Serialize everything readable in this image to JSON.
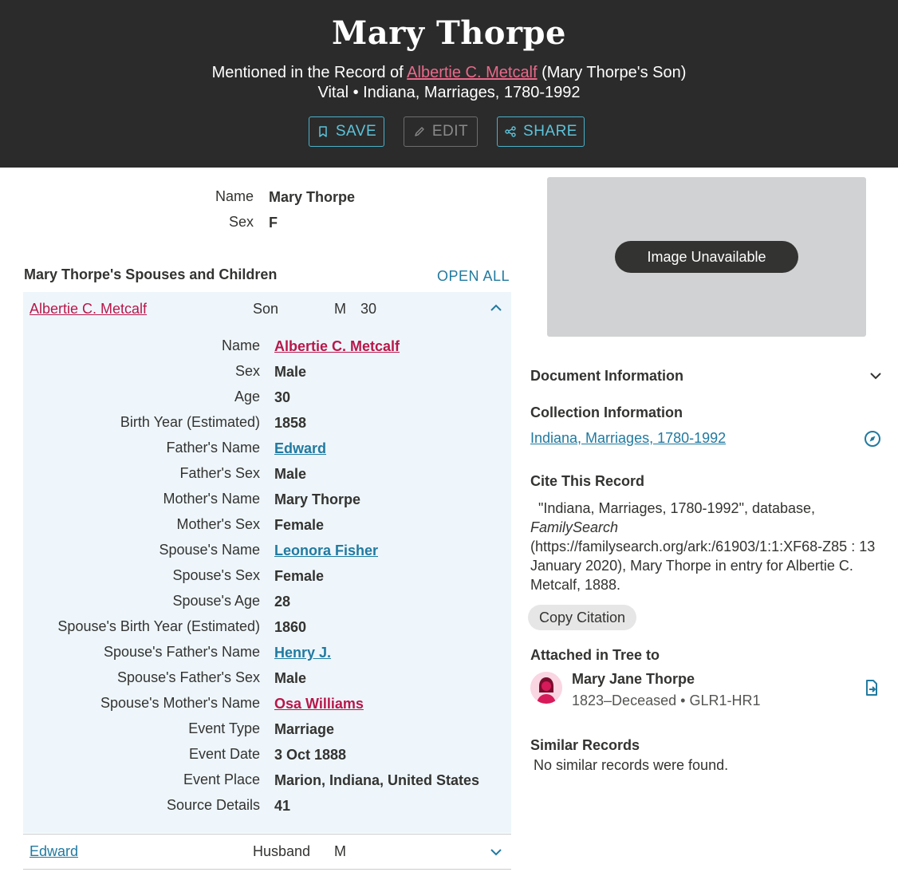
{
  "header": {
    "title": "Mary Thorpe",
    "mentioned_prefix": "Mentioned in the Record of ",
    "mentioned_link": "Albertie C. Metcalf",
    "mentioned_suffix": " (Mary Thorpe's Son)",
    "collection_line": "Vital • Indiana, Marriages, 1780-1992",
    "buttons": {
      "save": "SAVE",
      "edit": "EDIT",
      "share": "SHARE"
    }
  },
  "summary": {
    "name_label": "Name",
    "name_value": "Mary Thorpe",
    "sex_label": "Sex",
    "sex_value": "F"
  },
  "spouses_section": {
    "title": "Mary Thorpe's Spouses and Children",
    "open_all": "OPEN ALL",
    "expanded": {
      "name": "Albertie C. Metcalf",
      "relationship": "Son",
      "sex": "M",
      "age": "30",
      "details": [
        {
          "label": "Name",
          "value": "Albertie C. Metcalf"
        },
        {
          "label": "Sex",
          "value": "Male"
        },
        {
          "label": "Age",
          "value": "30"
        },
        {
          "label": "Birth Year (Estimated)",
          "value": "1858"
        },
        {
          "label": "Father's Name",
          "value": "Edward"
        },
        {
          "label": "Father's Sex",
          "value": "Male"
        },
        {
          "label": "Mother's Name",
          "value": "Mary Thorpe"
        },
        {
          "label": "Mother's Sex",
          "value": "Female"
        },
        {
          "label": "Spouse's Name",
          "value": "Leonora Fisher"
        },
        {
          "label": "Spouse's Sex",
          "value": "Female"
        },
        {
          "label": "Spouse's Age",
          "value": "28"
        },
        {
          "label": "Spouse's Birth Year (Estimated)",
          "value": "1860"
        },
        {
          "label": "Spouse's Father's Name",
          "value": "Henry J."
        },
        {
          "label": "Spouse's Father's Sex",
          "value": "Male"
        },
        {
          "label": "Spouse's Mother's Name",
          "value": "Osa Williams"
        },
        {
          "label": "Event Type",
          "value": "Marriage"
        },
        {
          "label": "Event Date",
          "value": "3 Oct 1888"
        },
        {
          "label": "Event Place",
          "value": "Marion, Indiana, United States"
        },
        {
          "label": "Source Details",
          "value": "41"
        }
      ]
    },
    "collapsed": {
      "name": "Edward",
      "relationship": "Husband",
      "sex": "M"
    }
  },
  "image_panel": {
    "label": "Image Unavailable"
  },
  "document_info": {
    "title": "Document Information"
  },
  "collection_info": {
    "title": "Collection Information",
    "link": "Indiana, Marriages, 1780-1992"
  },
  "cite": {
    "title": "Cite This Record",
    "part1": "\"Indiana, Marriages, 1780-1992\", database,",
    "italic": "FamilySearch",
    "part2": "(https://familysearch.org/ark:/61903/1:1:XF68-Z85 : 13 January 2020), Mary Thorpe in entry for Albertie C. Metcalf, 1888.",
    "copy_button": "Copy Citation"
  },
  "attached": {
    "title": "Attached in Tree to",
    "person_name": "Mary Jane Thorpe",
    "dates": "1823–Deceased",
    "separator": "•",
    "pid": "GLR1-HR1"
  },
  "similar": {
    "title": "Similar Records",
    "message": "No similar records were found."
  },
  "colors": {
    "header_bg": "#2b2b2b",
    "link_red": "#b8174a",
    "link_blue": "#217aa0",
    "accent_teal": "#4ab1c9",
    "panel_bg": "#eef6fb"
  }
}
